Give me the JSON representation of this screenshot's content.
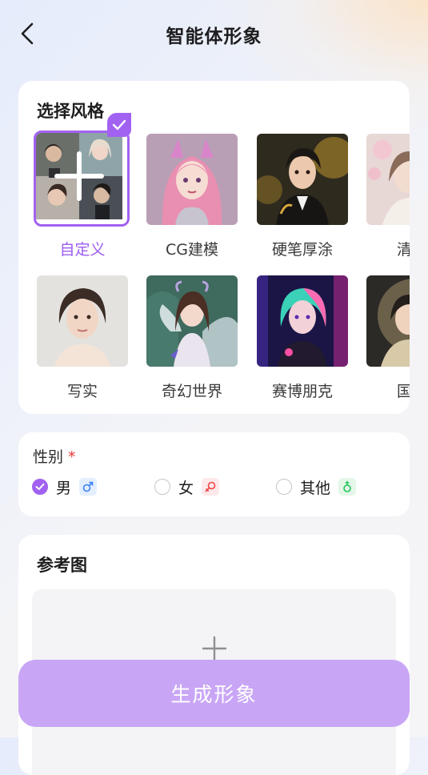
{
  "header": {
    "title": "智能体形象"
  },
  "style_section": {
    "title": "选择风格",
    "row1": [
      {
        "label": "自定义",
        "selected": true
      },
      {
        "label": "CG建模",
        "selected": false
      },
      {
        "label": "硬笔厚涂",
        "selected": false
      },
      {
        "label": "清新",
        "selected": false
      }
    ],
    "row2": [
      {
        "label": "写实",
        "selected": false
      },
      {
        "label": "奇幻世界",
        "selected": false
      },
      {
        "label": "赛博朋克",
        "selected": false
      },
      {
        "label": "国风",
        "selected": false
      }
    ]
  },
  "gender": {
    "label": "性别",
    "required_mark": "*",
    "options": [
      {
        "label": "男",
        "symbol": "♂",
        "checked": true,
        "color": "#3b82f6"
      },
      {
        "label": "女",
        "symbol": "♀",
        "checked": false,
        "color": "#ef4444"
      },
      {
        "label": "其他",
        "symbol": "⚲",
        "checked": false,
        "color": "#22c55e"
      }
    ]
  },
  "reference": {
    "title": "参考图"
  },
  "generate_button": {
    "label": "生成形象"
  },
  "colors": {
    "accent": "#a262f1",
    "button": "#c9a6f5",
    "required": "#e53935"
  }
}
